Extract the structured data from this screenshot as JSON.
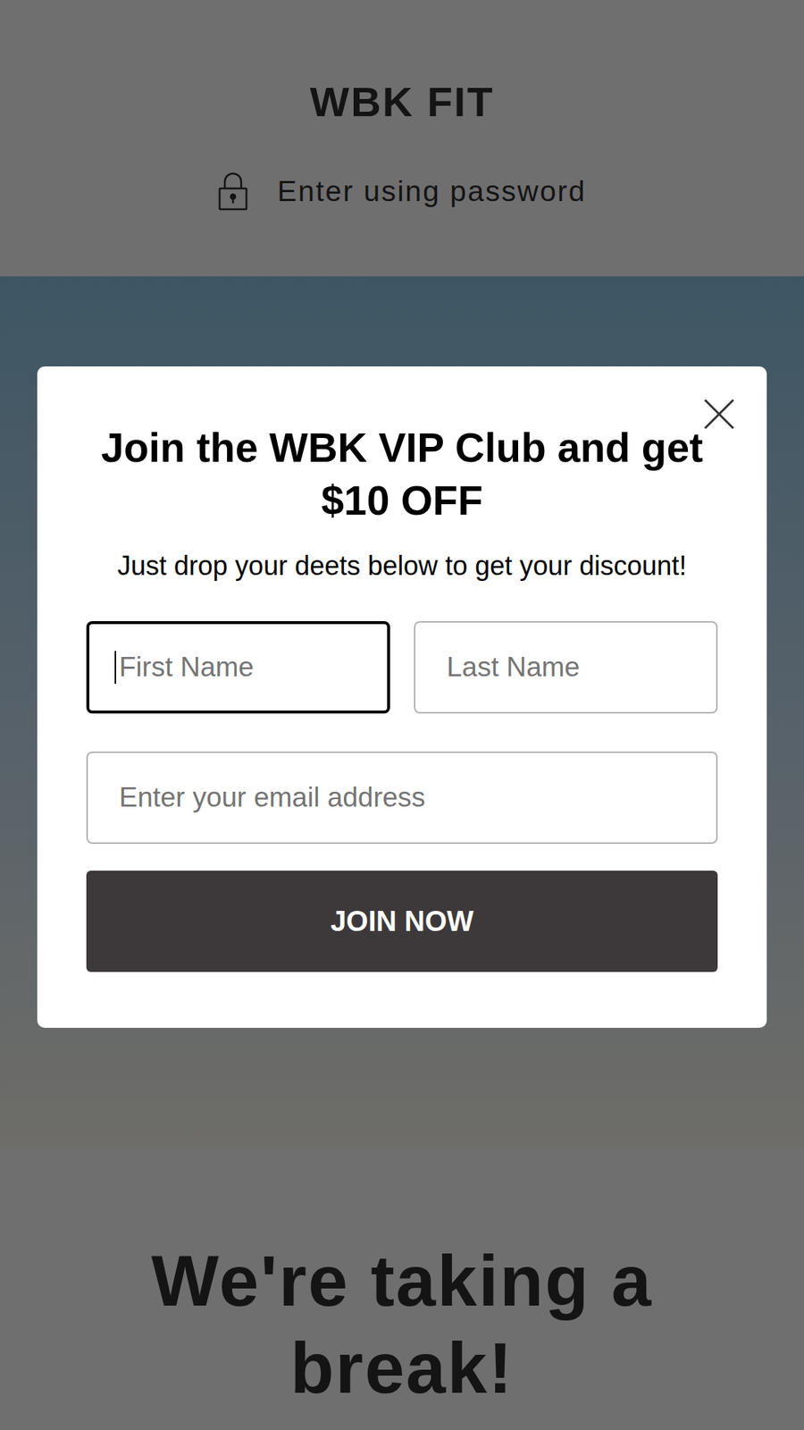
{
  "header": {
    "logo": "WBK FIT",
    "password_link": "Enter using password"
  },
  "page": {
    "heading": "We're taking a break!"
  },
  "popup": {
    "title": "Join the WBK VIP Club and get $10 OFF",
    "subtitle": "Just drop your deets below to get your discount!",
    "name_fields": [
      {
        "placeholder": "First Name",
        "focused": true
      },
      {
        "placeholder": "Last Name",
        "focused": false
      }
    ],
    "email_field": {
      "placeholder": "Enter your email address",
      "focused": false
    },
    "button": "JOIN NOW"
  }
}
